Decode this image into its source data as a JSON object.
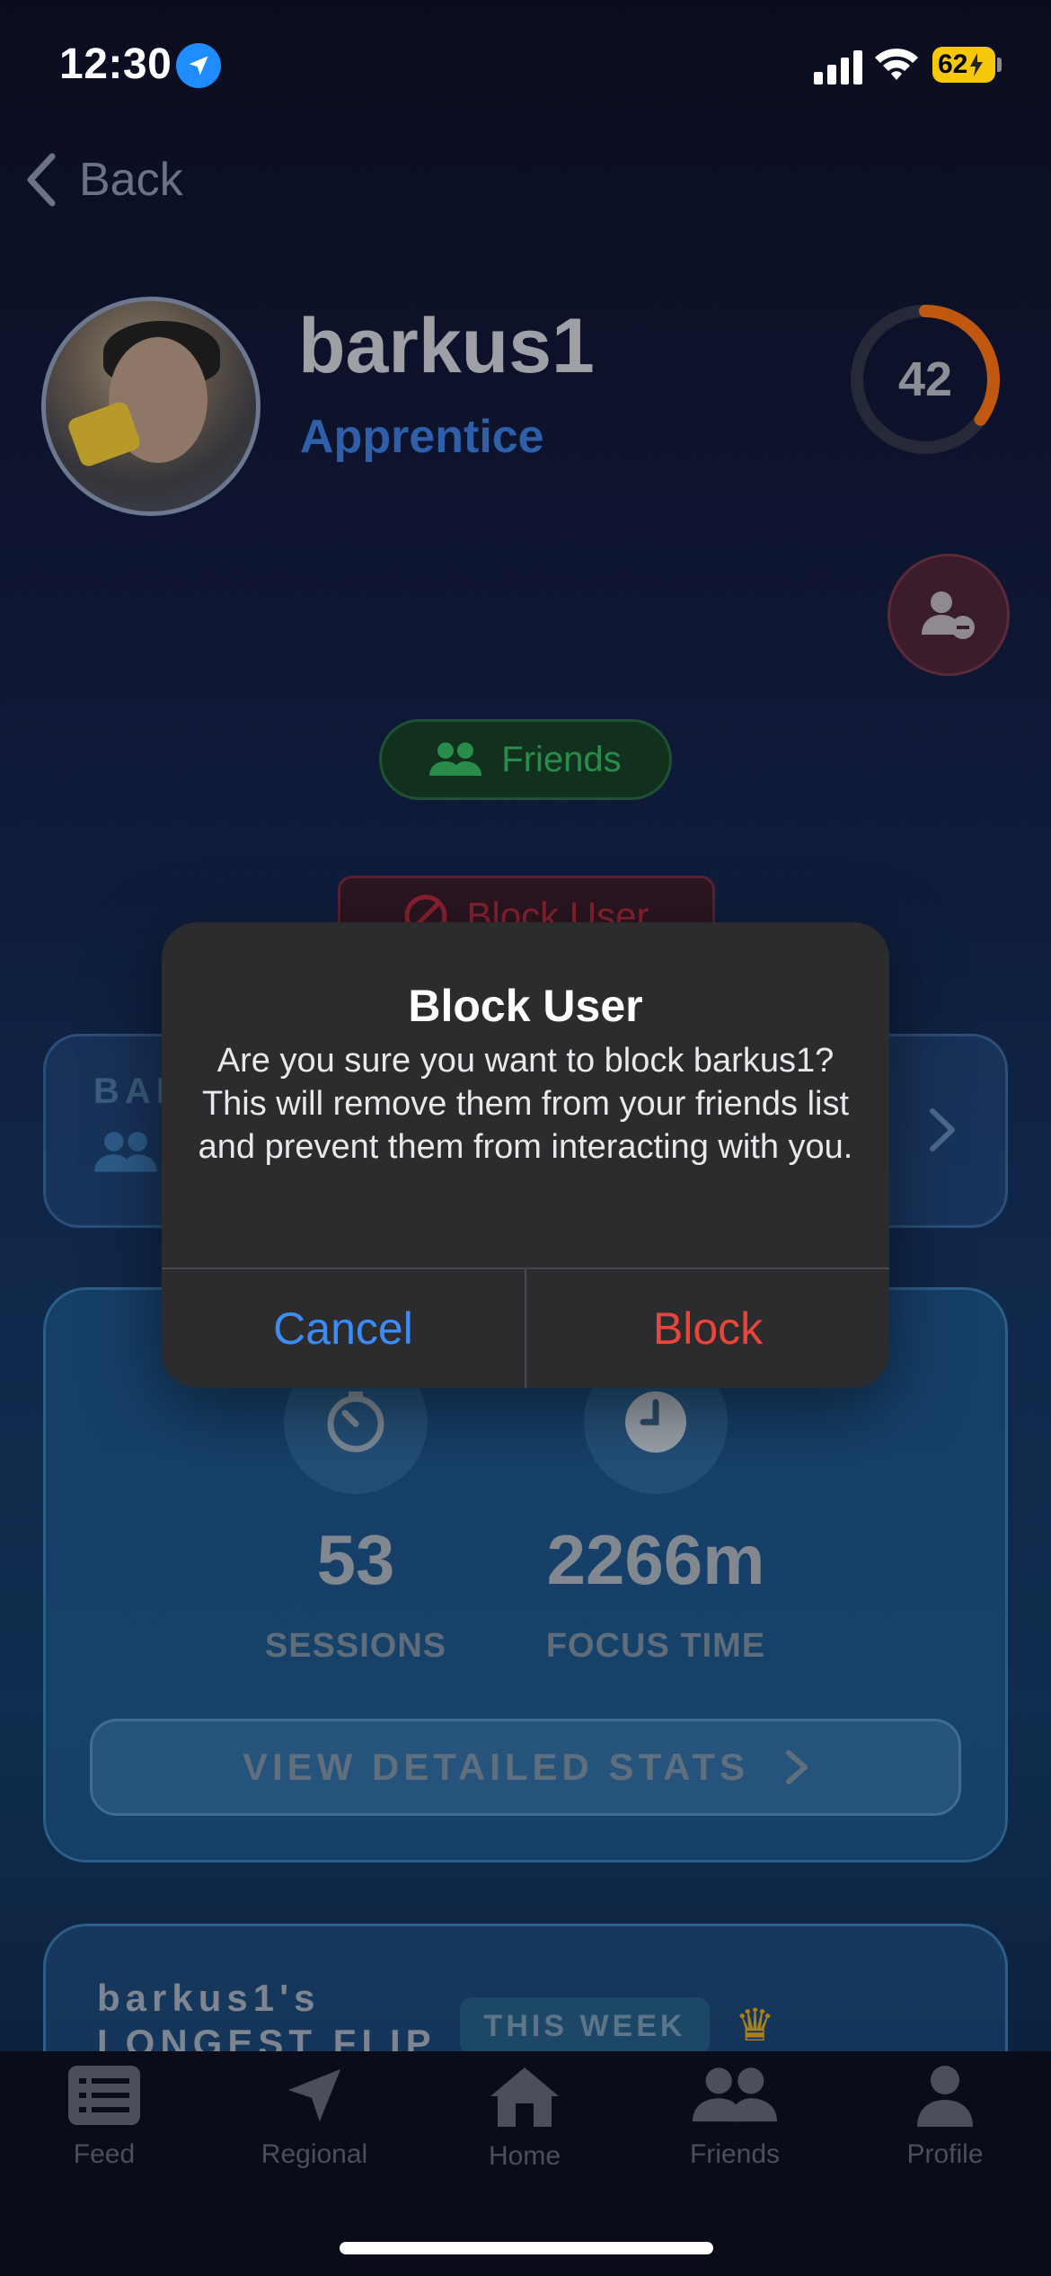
{
  "status_bar": {
    "time": "12:30",
    "battery": "62"
  },
  "nav": {
    "back_label": "Back"
  },
  "profile": {
    "username": "barkus1",
    "rank": "Apprentice",
    "level": "42",
    "level_progress": 0.35,
    "friend_status": "Friends",
    "block_button_label": "Block User"
  },
  "friends_card": {
    "title": "BAR"
  },
  "stats": {
    "sessions_value": "53",
    "sessions_label": "SESSIONS",
    "focus_value": "2266m",
    "focus_label": "FOCUS TIME",
    "detail_button": "VIEW DETAILED STATS"
  },
  "flip_card": {
    "title_line1": "barkus1's",
    "title_line2": "LONGEST FLIP",
    "badge": "THIS WEEK"
  },
  "tabs": [
    {
      "label": "Feed",
      "icon": "feed-icon"
    },
    {
      "label": "Regional",
      "icon": "location-arrow-icon"
    },
    {
      "label": "Home",
      "icon": "home-icon"
    },
    {
      "label": "Friends",
      "icon": "friends-icon"
    },
    {
      "label": "Profile",
      "icon": "profile-icon"
    }
  ],
  "alert": {
    "title": "Block User",
    "message": "Are you sure you want to block barkus1? This will remove them from your friends list and prevent them from interacting with you.",
    "cancel_label": "Cancel",
    "confirm_label": "Block"
  },
  "colors": {
    "accent_blue": "#3d8cf5",
    "destructive_red": "#e8453c",
    "level_ring": "#c0580f",
    "battery": "#f5c90a"
  }
}
